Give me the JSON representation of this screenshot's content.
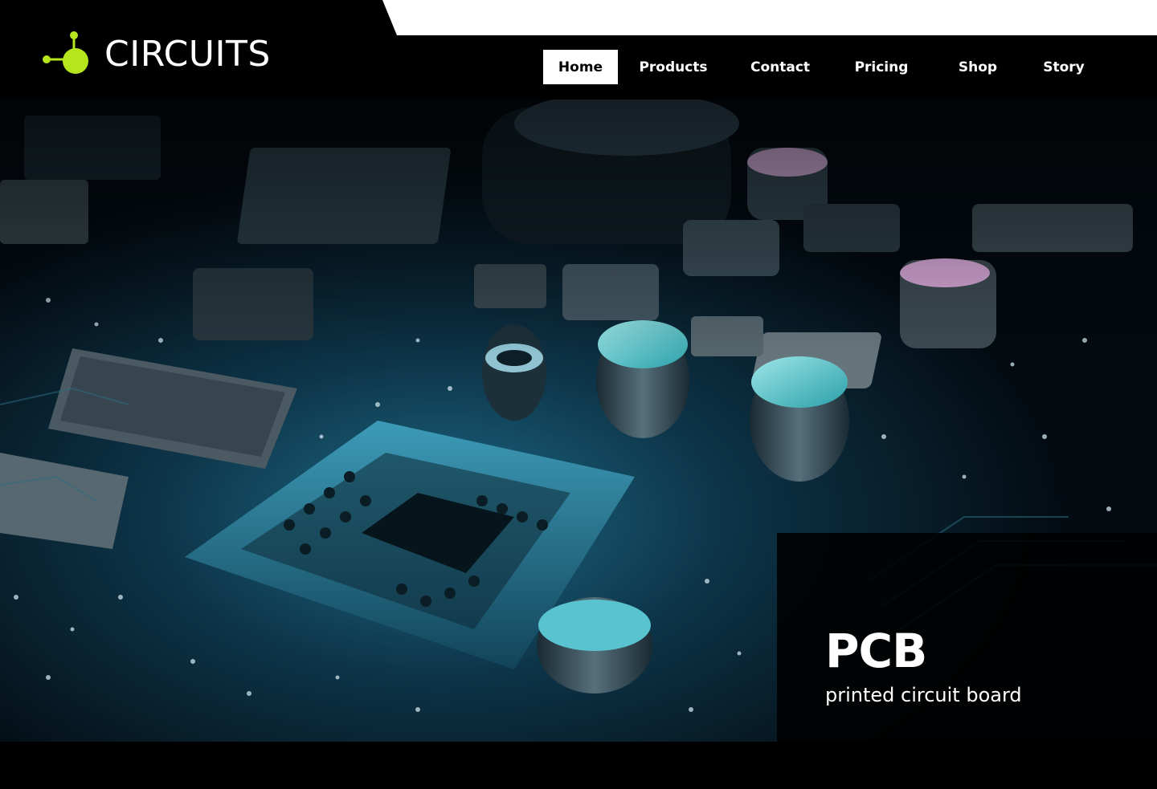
{
  "brand": {
    "name": "CIRCUITS",
    "logo_icon": "molecule-node-icon",
    "accent_color": "#b5e61d"
  },
  "nav": {
    "items": [
      {
        "label": "Home",
        "active": true
      },
      {
        "label": "Products",
        "active": false
      },
      {
        "label": "Contact",
        "active": false
      },
      {
        "label": "Pricing",
        "active": false
      },
      {
        "label": "Shop",
        "active": false
      },
      {
        "label": "Story",
        "active": false
      }
    ]
  },
  "hero": {
    "image": "circuit-board-photo",
    "caption": {
      "title": "PCB",
      "subtitle": "printed circuit board"
    }
  },
  "colors": {
    "background": "#000000",
    "nav_active_bg": "#ffffff",
    "hero_tint": "#0b3a4e"
  }
}
